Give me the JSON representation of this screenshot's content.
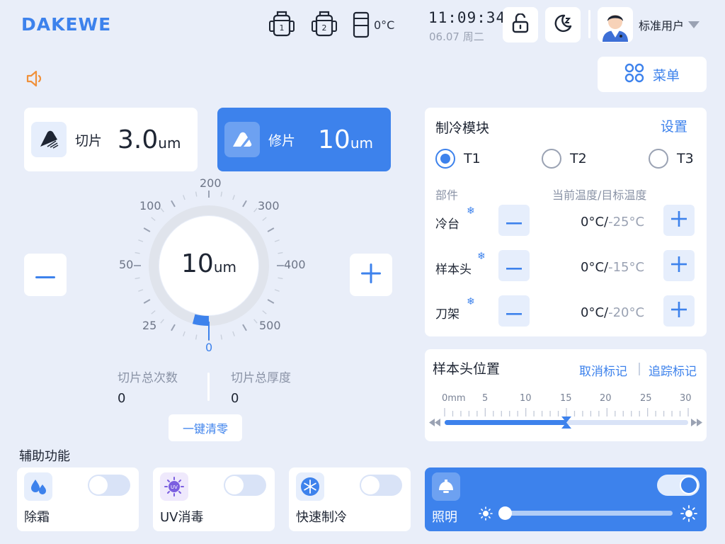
{
  "header": {
    "logo": "DAKEWE",
    "tank1_label": "1",
    "tank2_label": "2",
    "chamber_temp": "0°C",
    "time": "11:09:34",
    "date": "06.07 周二",
    "user_name": "标准用户"
  },
  "menu": {
    "label": "菜单"
  },
  "modes": {
    "cut": {
      "label": "切片",
      "value": "3.0",
      "unit": "um"
    },
    "trim": {
      "label": "修片",
      "value": "10",
      "unit": "um"
    }
  },
  "dial": {
    "value": "10",
    "unit": "um",
    "ticks": [
      "0",
      "25",
      "50",
      "100",
      "200",
      "300",
      "400",
      "500"
    ]
  },
  "stats": {
    "total_count_label": "切片总次数",
    "total_count": "0",
    "total_thickness_label": "切片总厚度",
    "total_thickness": "0",
    "reset_label": "一键清零"
  },
  "cooling": {
    "title": "制冷模块",
    "settings_label": "设置",
    "options": [
      "T1",
      "T2",
      "T3"
    ],
    "selected": "T1",
    "col_part": "部件",
    "col_temp": "当前温度/目标温度",
    "rows": [
      {
        "name": "冷台",
        "current": "0°C/",
        "target": "-25°C"
      },
      {
        "name": "样本头",
        "current": "0°C/",
        "target": "-15°C"
      },
      {
        "name": "刀架",
        "current": "0°C/",
        "target": "-20°C"
      }
    ]
  },
  "position": {
    "title": "样本头位置",
    "cancel_mark": "取消标记",
    "track_mark": "追踪标记",
    "scale": [
      "0mm",
      "5",
      "10",
      "15",
      "20",
      "25",
      "30"
    ],
    "value_mm": 15
  },
  "aux": {
    "title": "辅助功能",
    "items": [
      {
        "name": "除霜",
        "on": false
      },
      {
        "name": "UV消毒",
        "icon_text": "UV",
        "on": false
      },
      {
        "name": "快速制冷",
        "on": false
      }
    ],
    "lighting": {
      "name": "照明",
      "on": true,
      "brightness": 0
    }
  },
  "colors": {
    "accent": "#3d82ec",
    "background": "#e9eef9",
    "warning": "#f0903a"
  }
}
